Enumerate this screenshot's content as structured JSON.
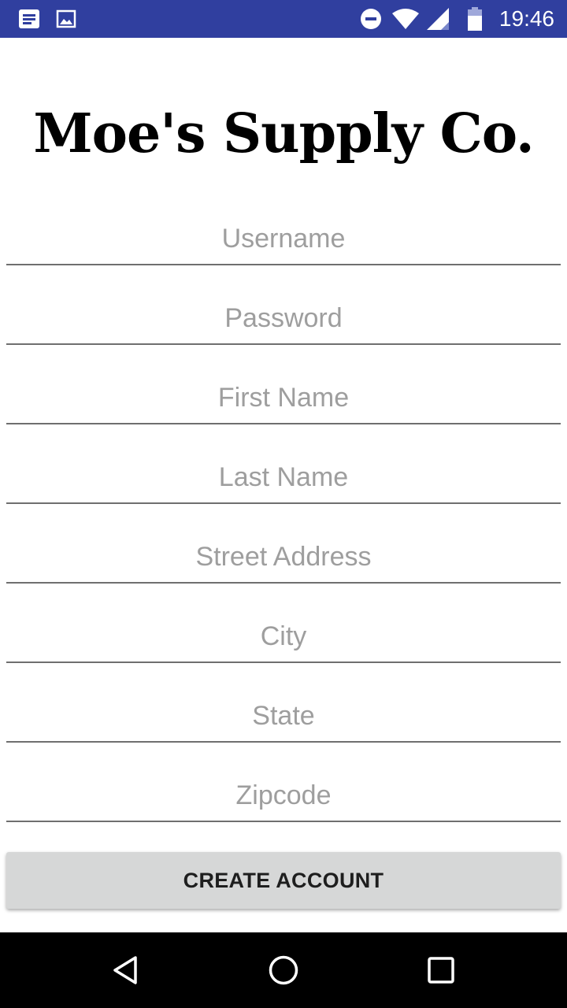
{
  "status_bar": {
    "time": "19:46",
    "icons": [
      "notification-icon",
      "image-icon",
      "do-not-disturb-icon",
      "wifi-icon",
      "signal-icon",
      "battery-icon"
    ],
    "background": "#303f9f"
  },
  "header": {
    "title": "Moe's Supply Co."
  },
  "form": {
    "username": {
      "placeholder": "Username",
      "value": ""
    },
    "password": {
      "placeholder": "Password",
      "value": ""
    },
    "first_name": {
      "placeholder": "First Name",
      "value": ""
    },
    "last_name": {
      "placeholder": "Last Name",
      "value": ""
    },
    "street_address": {
      "placeholder": "Street Address",
      "value": ""
    },
    "city": {
      "placeholder": "City",
      "value": ""
    },
    "state": {
      "placeholder": "State",
      "value": ""
    },
    "zipcode": {
      "placeholder": "Zipcode",
      "value": ""
    }
  },
  "actions": {
    "create_account_label": "CREATE ACCOUNT"
  },
  "nav_bar": {
    "icons": [
      "back-icon",
      "home-icon",
      "recents-icon"
    ]
  }
}
